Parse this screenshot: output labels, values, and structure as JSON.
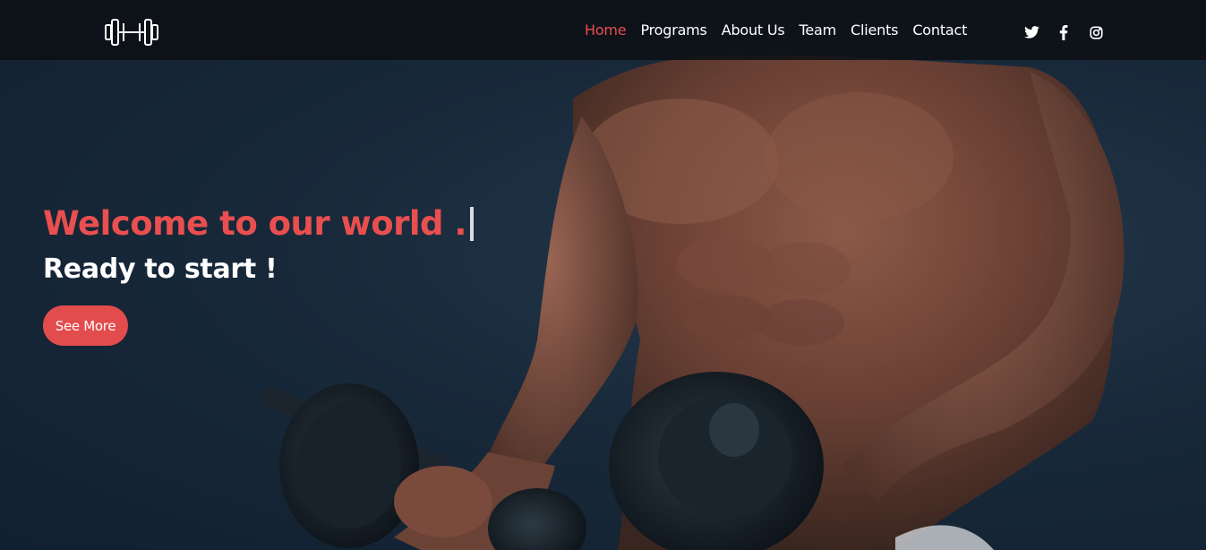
{
  "nav": {
    "links": [
      {
        "label": "Home",
        "active": true
      },
      {
        "label": "Programs",
        "active": false
      },
      {
        "label": "About Us",
        "active": false
      },
      {
        "label": "Team",
        "active": false
      },
      {
        "label": "Clients",
        "active": false
      },
      {
        "label": "Contact",
        "active": false
      }
    ],
    "social_icons": [
      "twitter-icon",
      "facebook-icon",
      "instagram-icon"
    ],
    "logo_icon": "dumbbell-icon"
  },
  "hero": {
    "title": "Welcome to our world .",
    "subtitle": "Ready to start !",
    "button_label": "See More",
    "background_image": "muscular-man-lifting-dumbbell"
  },
  "colors": {
    "accent": "#e94f4f",
    "navbar": "#0c1014",
    "background": "#182836",
    "text": "#ffffff"
  }
}
